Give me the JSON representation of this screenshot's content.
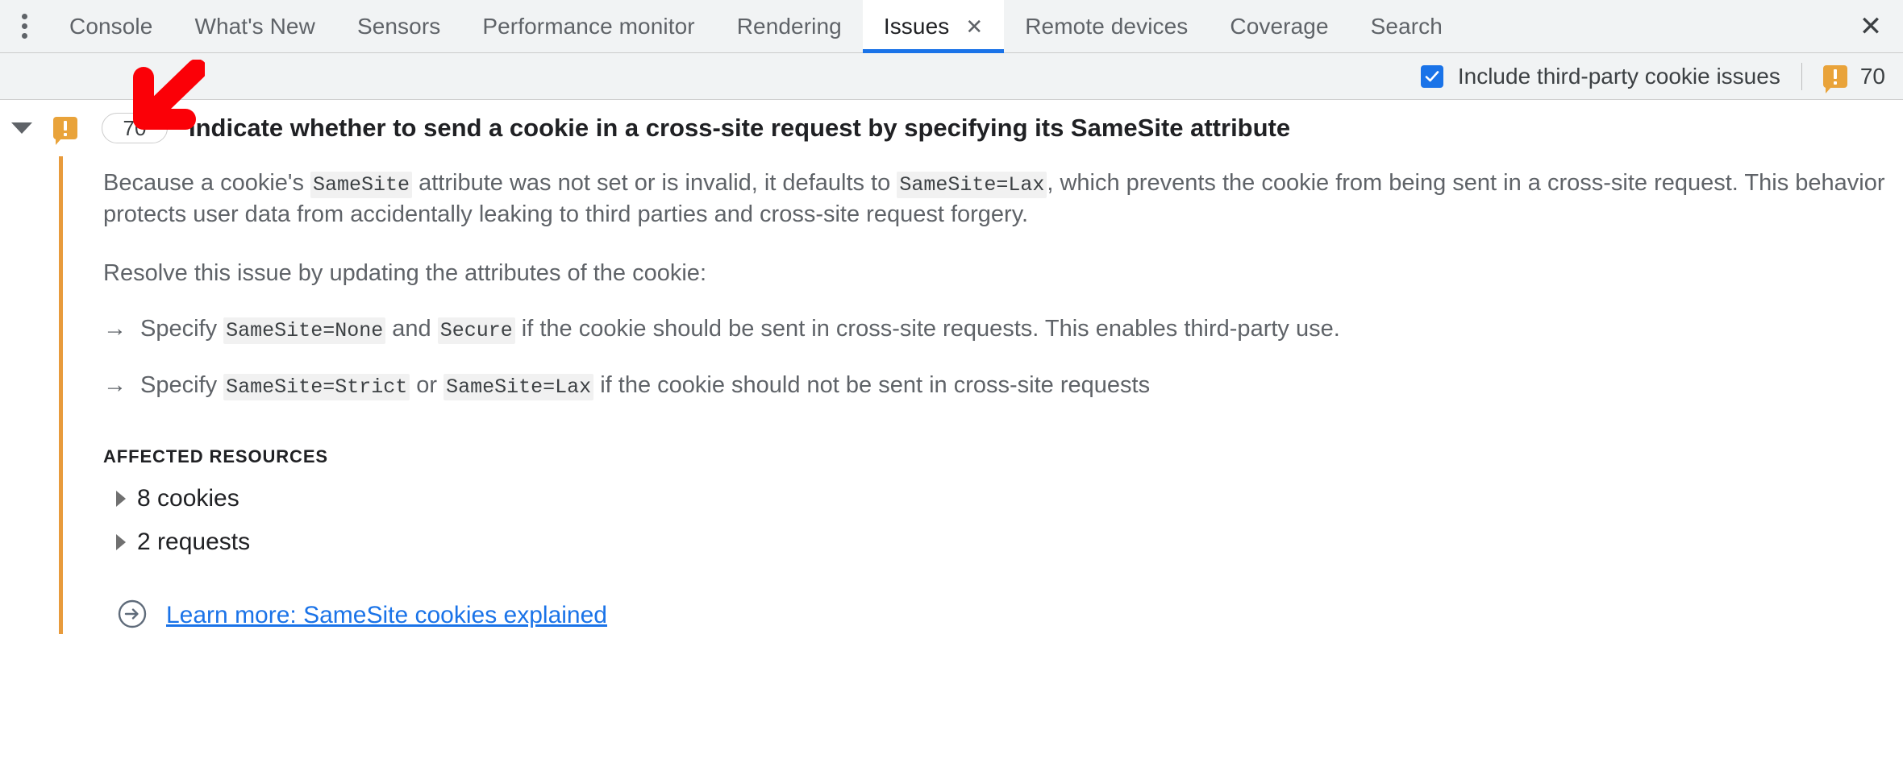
{
  "tabbar": {
    "menu_icon": "kebab-menu-icon",
    "tabs": [
      {
        "label": "Console",
        "active": false
      },
      {
        "label": "What's New",
        "active": false
      },
      {
        "label": "Sensors",
        "active": false
      },
      {
        "label": "Performance monitor",
        "active": false
      },
      {
        "label": "Rendering",
        "active": false
      },
      {
        "label": "Issues",
        "active": true,
        "closable": true
      },
      {
        "label": "Remote devices",
        "active": false
      },
      {
        "label": "Coverage",
        "active": false
      },
      {
        "label": "Search",
        "active": false
      }
    ],
    "tab_close_glyph": "✕",
    "panel_close_glyph": "✕"
  },
  "toolbar": {
    "checkbox_label": "Include third-party cookie issues",
    "checkbox_checked": true,
    "warning_count": "70"
  },
  "issue": {
    "expanded": true,
    "count_badge": "70",
    "title": "Indicate whether to send a cookie in a cross-site request by specifying its SameSite attribute",
    "paragraph1": {
      "p1": "Because a cookie's ",
      "code1": "SameSite",
      "p2": " attribute was not set or is invalid, it defaults to ",
      "code2": "SameSite=Lax",
      "p3": ", which prevents the cookie from being sent in a cross-site request. This behavior protects user data from accidentally leaking to third parties and cross-site request forgery."
    },
    "paragraph2": "Resolve this issue by updating the attributes of the cookie:",
    "bullet_mark": "→",
    "bullets": [
      {
        "p1": "Specify ",
        "code1": "SameSite=None",
        "p2": " and ",
        "code2": "Secure",
        "p3": " if the cookie should be sent in cross-site requests. This enables third-party use."
      },
      {
        "p1": "Specify ",
        "code1": "SameSite=Strict",
        "p2": " or ",
        "code2": "SameSite=Lax",
        "p3": " if the cookie should not be sent in cross-site requests"
      }
    ],
    "affected_resources_title": "AFFECTED RESOURCES",
    "resources": [
      {
        "label": "8 cookies"
      },
      {
        "label": "2 requests"
      }
    ],
    "learn_more_label": "Learn more: SameSite cookies explained"
  },
  "annotation": {
    "arrow_direction": "down-left",
    "arrow_color": "#fb0007"
  },
  "colors": {
    "accent_blue": "#1a73e8",
    "warning_orange": "#e9a33a",
    "issue_stripe": "#e89b3c",
    "tabbar_bg": "#f1f3f4",
    "text_primary": "#202124",
    "text_secondary": "#5f6368"
  }
}
